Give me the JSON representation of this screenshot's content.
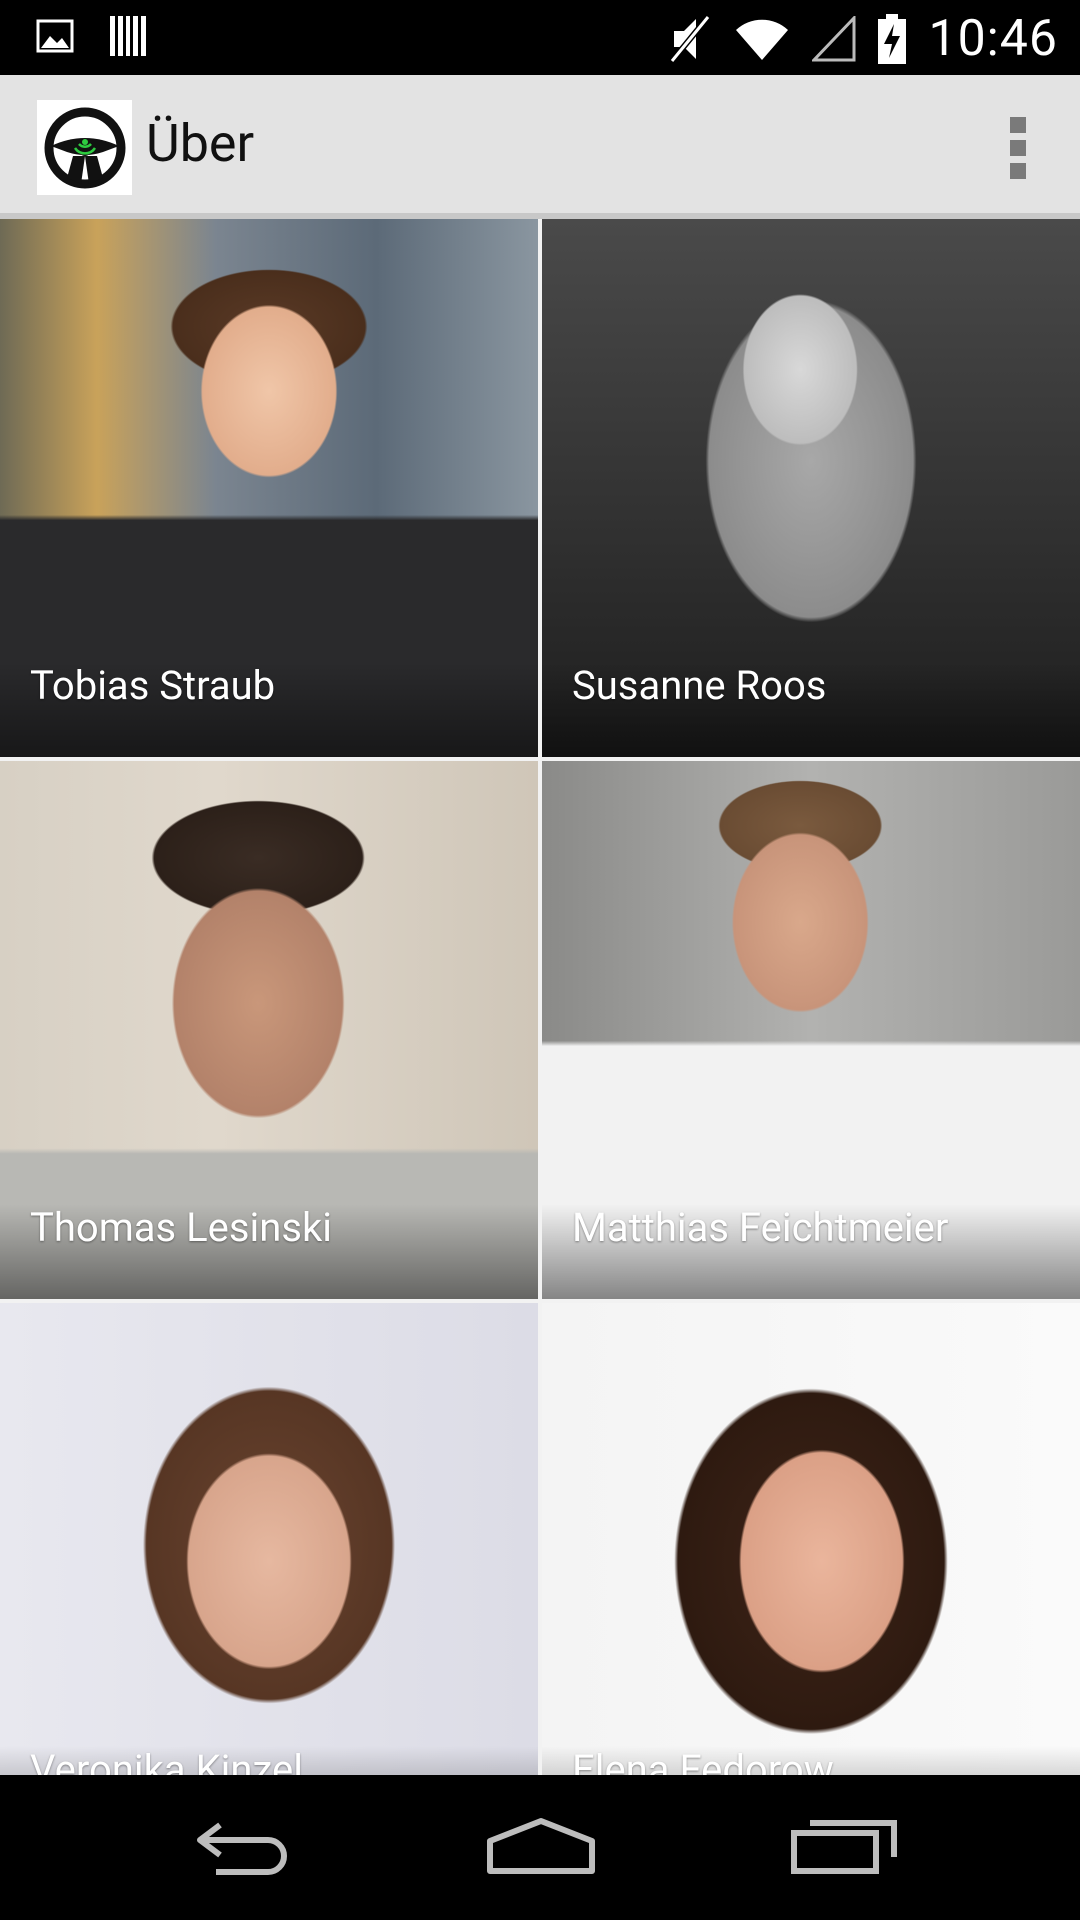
{
  "status_bar": {
    "time": "10:46",
    "left_icons": [
      "image-icon",
      "barcode-icon"
    ],
    "right_icons": [
      "mute-icon",
      "wifi-icon",
      "signal-icon",
      "battery-charging-icon"
    ]
  },
  "action_bar": {
    "title": "Über",
    "logo_icon": "steering-wheel-icon",
    "overflow_icon": "overflow-menu-icon"
  },
  "people": [
    {
      "name": "Tobias Straub"
    },
    {
      "name": "Susanne Roos"
    },
    {
      "name": "Thomas Lesinski"
    },
    {
      "name": "Matthias Feichtmeier"
    },
    {
      "name": "Veronika Kinzel"
    },
    {
      "name": "Elena Fedorow"
    }
  ],
  "nav_bar": {
    "buttons": [
      "back-icon",
      "home-icon",
      "recents-icon"
    ]
  },
  "colors": {
    "action_bar_bg": "#e3e3e3",
    "accent_green": "#2ecc40",
    "status_bar_bg": "#000000"
  }
}
